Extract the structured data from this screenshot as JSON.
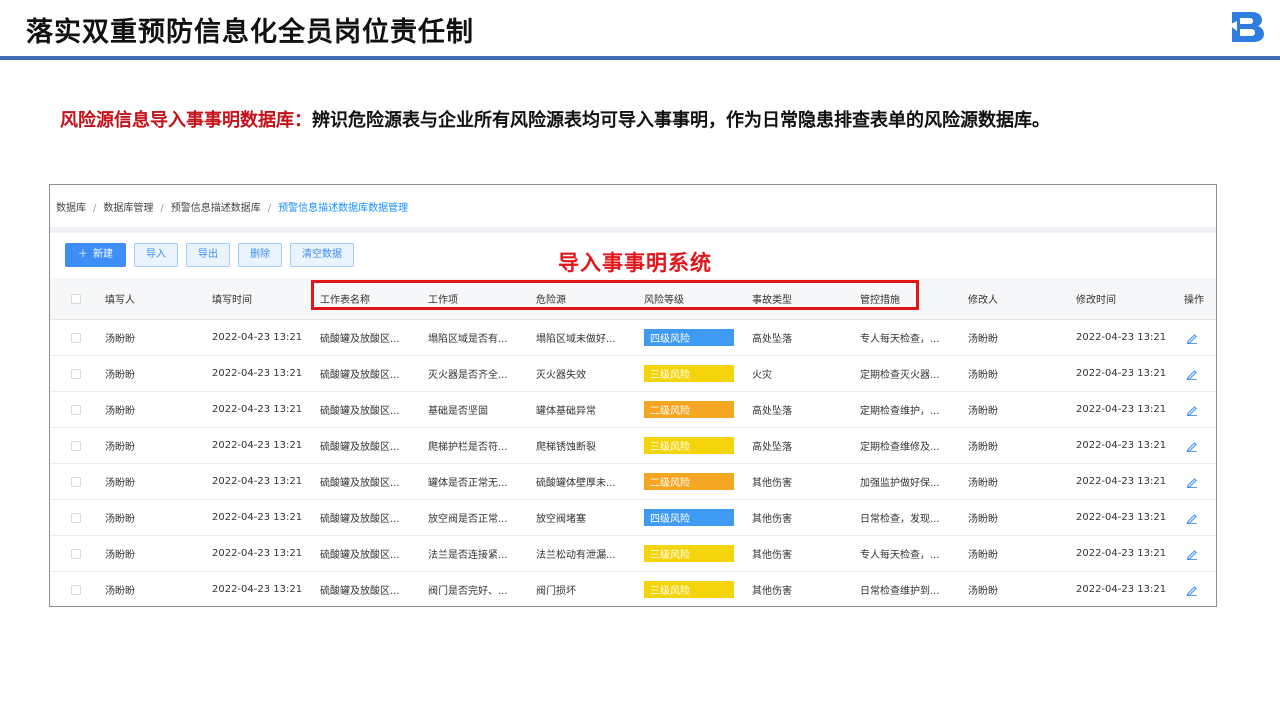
{
  "slide": {
    "title": "落实双重预防信息化全员岗位责任制",
    "intro_highlight": "风险源信息导入事事明数据库：",
    "intro_text": "辨识危险源表与企业所有风险源表均可导入事事明，作为日常隐患排查表单的风险源数据库。",
    "annotation_label": "导入事事明系统"
  },
  "breadcrumb": [
    "数据库",
    "数据库管理",
    "预警信息描述数据库",
    "预警信息描述数据库数据管理"
  ],
  "toolbar": {
    "new_label": "新建",
    "import_label": "导入",
    "export_label": "导出",
    "delete_label": "删除",
    "clear_label": "清空数据"
  },
  "colors": {
    "level4": "#3f9bf2",
    "level3": "#f4d40b",
    "level2": "#f5a623",
    "accent": "#3e8ef7",
    "annotation": "#e4141b"
  },
  "table": {
    "headers": [
      "填写人",
      "填写时间",
      "工作表名称",
      "工作项",
      "危险源",
      "风险等级",
      "事故类型",
      "管控措施",
      "修改人",
      "修改时间",
      "操作"
    ],
    "rows": [
      [
        "汤盼盼",
        "2022-04-23 13:21",
        "硫酸罐及放酸区...",
        "塌陷区域是否有...",
        "塌陷区域未做好...",
        "四级风险",
        "高处坠落",
        "专人每天检查，...",
        "汤盼盼",
        "2022-04-23 13:21"
      ],
      [
        "汤盼盼",
        "2022-04-23 13:21",
        "硫酸罐及放酸区...",
        "灭火器是否齐全...",
        "灭火器失效",
        "三级风险",
        "火灾",
        "定期检查灭火器...",
        "汤盼盼",
        "2022-04-23 13:21"
      ],
      [
        "汤盼盼",
        "2022-04-23 13:21",
        "硫酸罐及放酸区...",
        "基础是否坚固",
        "罐体基础异常",
        "二级风险",
        "高处坠落",
        "定期检查维护，...",
        "汤盼盼",
        "2022-04-23 13:21"
      ],
      [
        "汤盼盼",
        "2022-04-23 13:21",
        "硫酸罐及放酸区...",
        "爬梯护栏是否符...",
        "爬梯锈蚀断裂",
        "三级风险",
        "高处坠落",
        "定期检查维修及...",
        "汤盼盼",
        "2022-04-23 13:21"
      ],
      [
        "汤盼盼",
        "2022-04-23 13:21",
        "硫酸罐及放酸区...",
        "罐体是否正常无...",
        "硫酸罐体壁厚未...",
        "二级风险",
        "其他伤害",
        "加强监护做好保...",
        "汤盼盼",
        "2022-04-23 13:21"
      ],
      [
        "汤盼盼",
        "2022-04-23 13:21",
        "硫酸罐及放酸区...",
        "放空阀是否正常...",
        "放空阀堵塞",
        "四级风险",
        "其他伤害",
        "日常检查，发现...",
        "汤盼盼",
        "2022-04-23 13:21"
      ],
      [
        "汤盼盼",
        "2022-04-23 13:21",
        "硫酸罐及放酸区...",
        "法兰是否连接紧...",
        "法兰松动有泄漏...",
        "三级风险",
        "其他伤害",
        "专人每天检查，...",
        "汤盼盼",
        "2022-04-23 13:21"
      ],
      [
        "汤盼盼",
        "2022-04-23 13:21",
        "硫酸罐及放酸区...",
        "阀门是否完好、...",
        "阀门损坏",
        "三级风险",
        "其他伤害",
        "日常检查维护到...",
        "汤盼盼",
        "2022-04-23 13:21"
      ]
    ],
    "row_actions": "edit-icon"
  }
}
